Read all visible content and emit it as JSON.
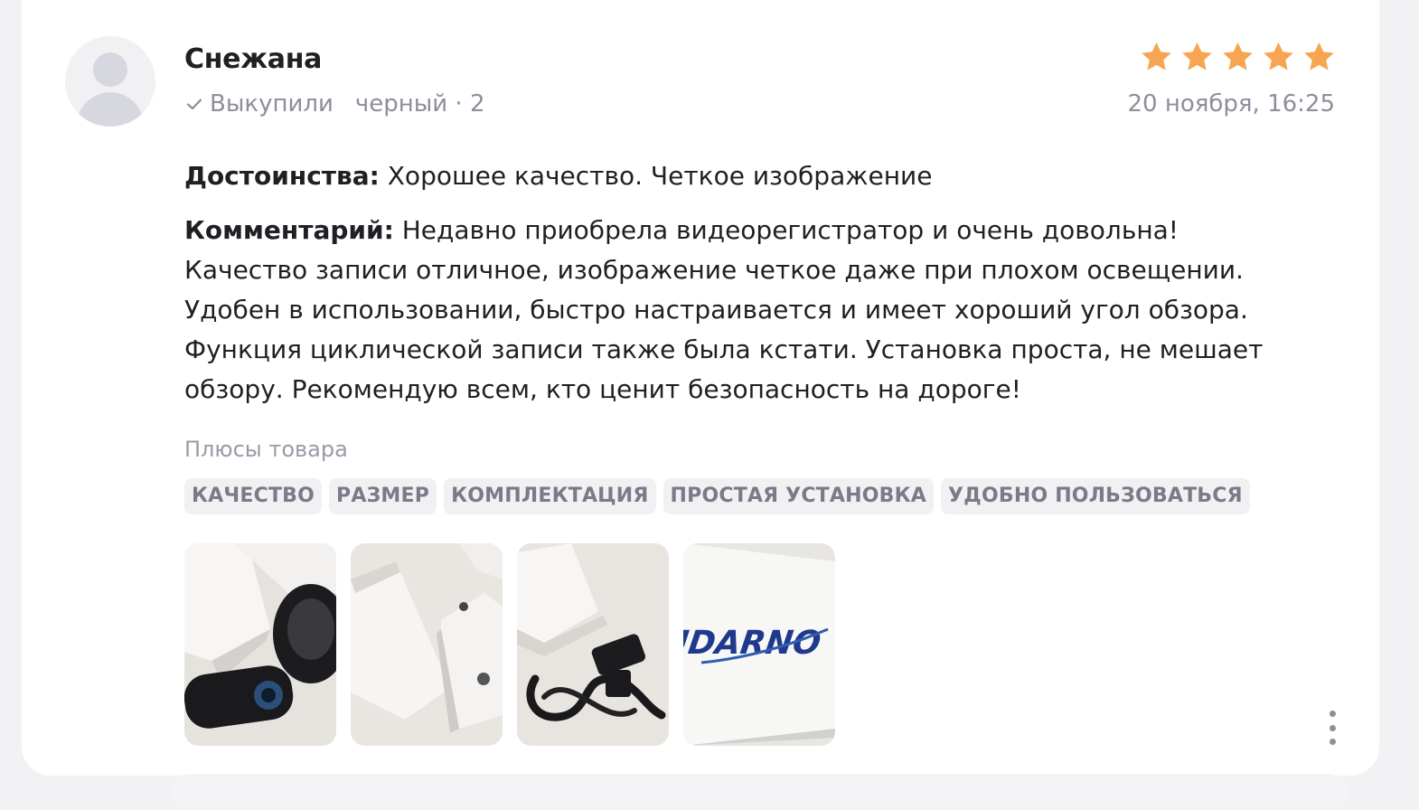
{
  "review": {
    "author": "Снежана",
    "purchase_status": "Выкупили",
    "variant": "черный · 2",
    "rating": 5,
    "rating_max": 5,
    "date": "20 ноября, 16:25",
    "advantages_label": "Достоинства:",
    "advantages_text": "Хорошее качество. Четкое изображение",
    "comment_label": "Комментарий:",
    "comment_text": "Недавно приобрела видеорегистратор и очень довольна! Качество записи отличное, изображение четкое даже при плохом освещении. Удобен в использовании, быстро настраивается и имеет хороший угол обзора. Функция циклической записи также была кстати. Установка проста, не мешает обзору. Рекомендую всем, кто ценит безопасность на дороге!",
    "pros_title": "Плюсы товара",
    "pros_tags": [
      "КАЧЕСТВО",
      "РАЗМЕР",
      "КОМПЛЕКТАЦИЯ",
      "ПРОСТАЯ УСТАНОВКА",
      "УДОБНО ПОЛЬЗОВАТЬСЯ"
    ],
    "photo_logo_text": "UDARNO"
  },
  "icons": {
    "check": "check-icon",
    "star": "star-icon",
    "more": "more-vertical-icon",
    "avatar": "user-avatar-placeholder"
  },
  "colors": {
    "star": "#f7a551",
    "muted_text": "#8e8e9c",
    "tag_bg": "#f1f1f4"
  }
}
